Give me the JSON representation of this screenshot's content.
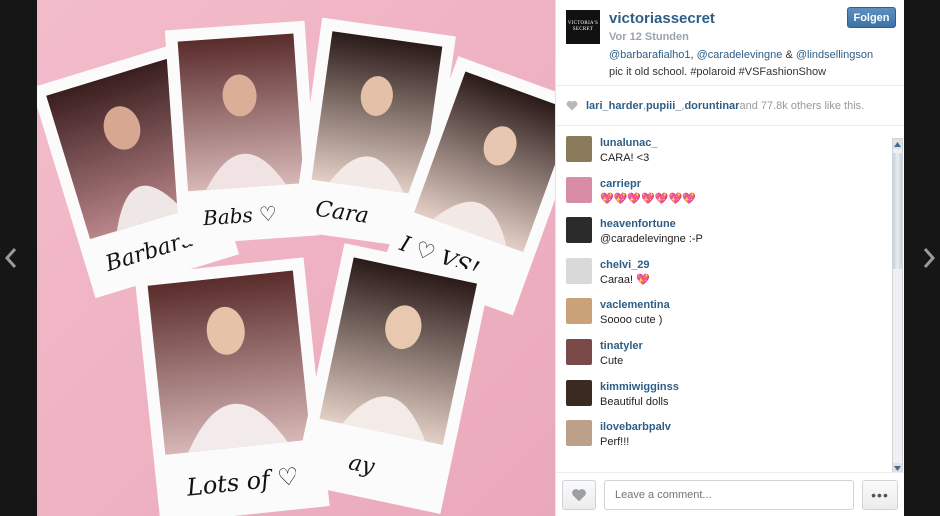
{
  "post": {
    "username": "victoriassecret",
    "time": "Vor 12 Stunden",
    "follow_label": "Folgen",
    "brand_logo_text": "VICTORIA'S SECRET",
    "caption": {
      "mention1": "@barbarafialho1",
      "sep1": ", ",
      "mention2": "@caradelevingne",
      "sep2": " & ",
      "mention3": "@lindsellingson",
      "text": "pic it old school. #polaroid #VSFashionShow"
    },
    "photo_signatures": [
      "Barbara",
      "Babs ♡",
      "Cara",
      "I ♡ VS!",
      "Lots of ♡",
      "ay"
    ]
  },
  "likes": {
    "user1": "lari_harder",
    "sep1": ", ",
    "user2": "pupiii_",
    "sep2": ", ",
    "user3": "doruntinar",
    "rest": " and 77.8k others like this."
  },
  "comments": [
    {
      "user": "lunalunac_",
      "text": "CARA! <3",
      "color": "#8a7a5c"
    },
    {
      "user": "carriepr",
      "text": "💖💖💖💖💖💖💖",
      "color": "#d98ca5"
    },
    {
      "user": "heavenfortune",
      "text": "@caradelevingne :-P",
      "color": "#2b2b2b"
    },
    {
      "user": "chelvi_29",
      "text": "Caraa! 💖",
      "color": "#d9d9d9"
    },
    {
      "user": "vaclementina",
      "text": "Soooo cute )",
      "color": "#c9a27a"
    },
    {
      "user": "tinatyler",
      "text": "Cute",
      "color": "#7a4a4a"
    },
    {
      "user": "kimmiwigginss",
      "text": "Beautiful dolls",
      "color": "#3b2a22"
    },
    {
      "user": "ilovebarbpalv",
      "text": "Perf!!!",
      "color": "#bca08a"
    }
  ],
  "composer": {
    "placeholder": "Leave a comment...",
    "more_label": "•••"
  },
  "icons": {
    "prev": "chevron-left-icon",
    "next": "chevron-right-icon",
    "heart": "heart-icon"
  },
  "colors": {
    "link": "#2e5e86",
    "follow": "#3c72a6",
    "backdrop": "#161616",
    "photo_bg": "#f1b6c3"
  }
}
